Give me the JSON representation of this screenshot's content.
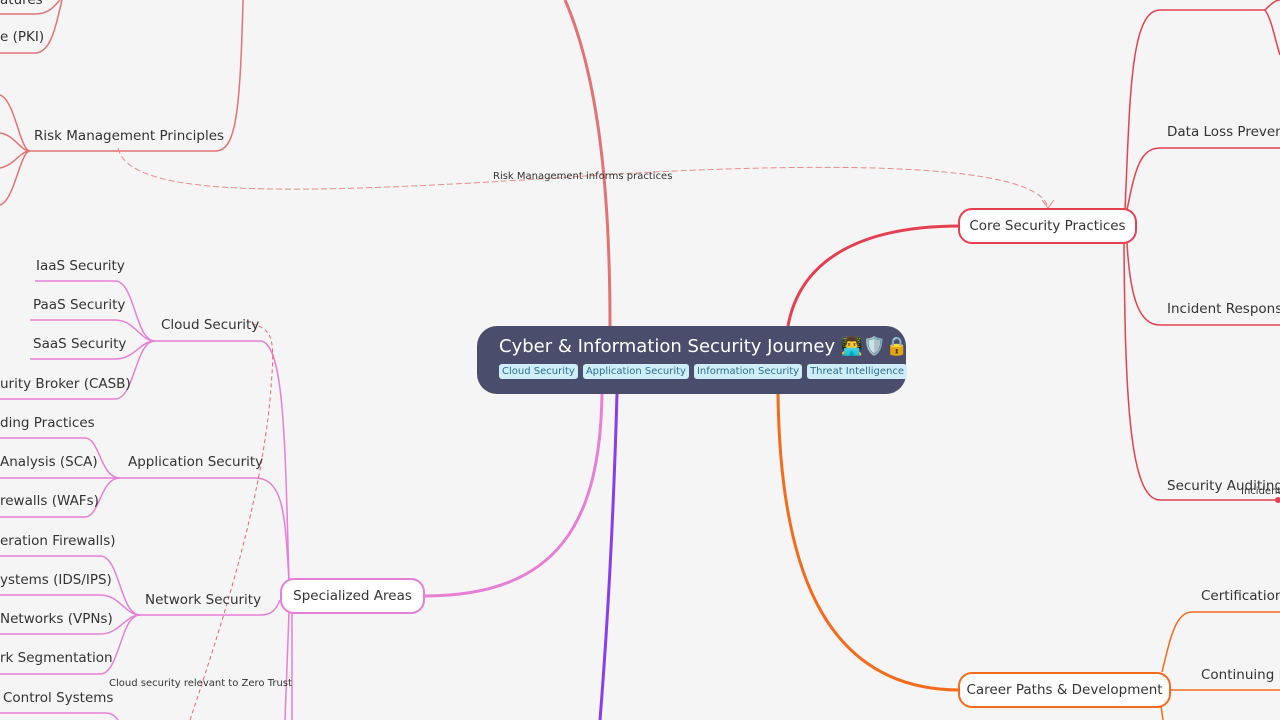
{
  "root": {
    "title": "Cyber & Information Security Journey",
    "emoji": "👨‍💻🛡️🔒",
    "tags": [
      "Cloud Security",
      "Application Security",
      "Information Security",
      "Threat Intelligence"
    ]
  },
  "branches": {
    "core": {
      "label": "Core Security Practices",
      "color": "#e5404f",
      "children": [
        "Data Loss Prevention",
        "Incident Response",
        "Security Auditing"
      ]
    },
    "career": {
      "label": "Career Paths & Development",
      "color": "#f56b1c",
      "children": [
        "Certifications",
        "Continuing Education"
      ]
    },
    "specialized": {
      "label": "Specialized Areas",
      "color": "#e77fd6",
      "children": [
        {
          "label": "Cloud Security",
          "children": [
            "IaaS Security",
            "PaaS Security",
            "SaaS Security",
            "Cloud Access Security Broker (CASB)"
          ]
        },
        {
          "label": "Application Security",
          "children": [
            "Secure Coding Practices",
            "Software Composition Analysis (SCA)",
            "Web Application Firewalls (WAFs)"
          ]
        },
        {
          "label": "Network Security",
          "children": [
            "Next-Generation Firewalls)",
            "Intrusion Detection/Prevention Systems (IDS/IPS)",
            "Virtual Private Networks (VPNs)",
            "Network Segmentation"
          ]
        },
        {
          "label": "Industrial Control Systems",
          "children": []
        }
      ]
    },
    "fundamentals": {
      "color": "#e37373",
      "children": [
        "Digital Signatures",
        "Public Key Infrastructure (PKI)",
        "Risk Management Principles"
      ]
    },
    "purple": {
      "color": "#8a3cf0"
    }
  },
  "visible_text": {
    "signatures_frag": "atures",
    "pki_frag": "e (PKI)",
    "risk": "Risk Management Principles",
    "casb_frag": "urity Broker (CASB)",
    "secure_coding_frag": "ding Practices",
    "sca_frag": "Analysis (SCA)",
    "waf_frag": "rewalls (WAFs)",
    "ngfw_frag": "eration Firewalls)",
    "ids_frag": "ystems (IDS/IPS)",
    "vpn_frag": "Networks (VPNs)",
    "seg_frag": "rk Segmentation",
    "ics_frag": "Control Systems",
    "dlp_frag": "Data Loss Preventio",
    "cont_ed_frag": "Continuing Ed",
    "incident_frag": "Incident"
  },
  "cross_links": [
    {
      "label": "Risk Management informs practices"
    },
    {
      "label": "Cloud security relevant to Zero Trust"
    }
  ]
}
